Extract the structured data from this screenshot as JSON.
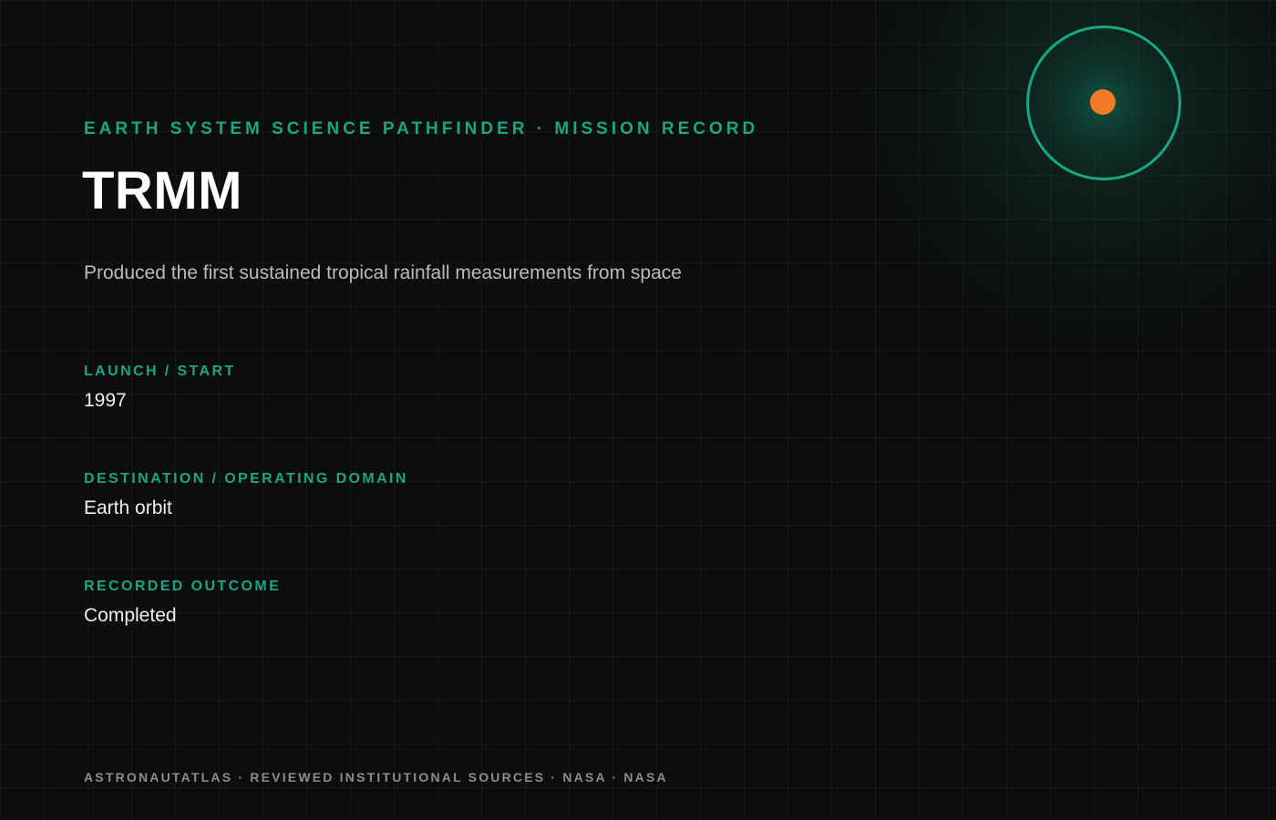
{
  "header": {
    "eyebrow": "EARTH SYSTEM SCIENCE PATHFINDER · MISSION RECORD",
    "title": "TRMM",
    "summary": "Produced the first sustained tropical rainfall measurements from space"
  },
  "fields": {
    "launch": {
      "label": "LAUNCH / START",
      "value": "1997"
    },
    "destination": {
      "label": "DESTINATION / OPERATING DOMAIN",
      "value": "Earth orbit"
    },
    "outcome": {
      "label": "RECORDED OUTCOME",
      "value": "Completed"
    }
  },
  "footer": {
    "sources": "ASTRONAUTATLAS · REVIEWED INSTITUTIONAL SOURCES · NASA · NASA"
  },
  "icons": {
    "orbit": "orbit-icon",
    "satellite": "satellite-dot-icon"
  },
  "colors": {
    "accent": "#1aa585",
    "ring": "#16a883",
    "satellite": "#f07c2a",
    "background": "#0c0e0e",
    "title": "#ffffff",
    "summary": "#b8bcba",
    "footer": "#8a8f8d"
  }
}
